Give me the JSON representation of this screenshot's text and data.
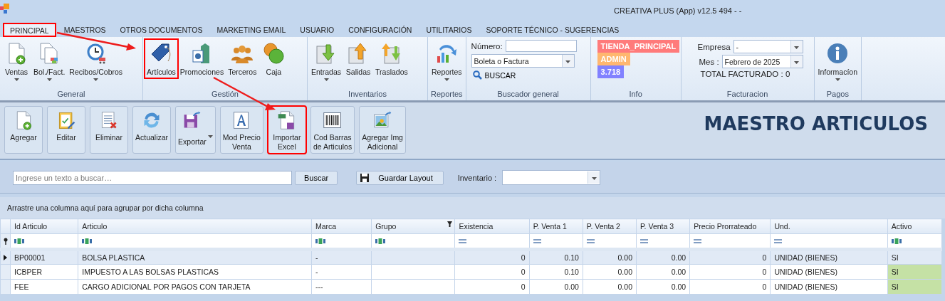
{
  "window": {
    "title": "CREATIVA PLUS (App) v12.5 494 - -"
  },
  "ribbon_tabs": [
    {
      "label": "PRINCIPAL",
      "selected": true,
      "highlighted": true
    },
    {
      "label": "MAESTROS",
      "selected": false,
      "highlighted": false
    },
    {
      "label": "OTROS DOCUMENTOS",
      "selected": false,
      "highlighted": false
    },
    {
      "label": "MARKETING EMAIL",
      "selected": false,
      "highlighted": false
    },
    {
      "label": "USUARIO",
      "selected": false,
      "highlighted": false
    },
    {
      "label": "CONFIGURACIÓN",
      "selected": false,
      "highlighted": false
    },
    {
      "label": "UTILITARIOS",
      "selected": false,
      "highlighted": false
    },
    {
      "label": "SOPORTE TÉCNICO - SUGERENCIAS",
      "selected": false,
      "highlighted": false
    }
  ],
  "ribbon_groups": [
    {
      "kind": "buttons",
      "label": "General",
      "buttons": [
        {
          "label": "Ventas",
          "has_menu": true,
          "highlighted": false
        },
        {
          "label": "Bol./Fact.",
          "has_menu": true,
          "highlighted": false
        },
        {
          "label": "Recibos/Cobros",
          "has_menu": true,
          "highlighted": false
        }
      ]
    },
    {
      "kind": "buttons",
      "label": "Gestión",
      "buttons": [
        {
          "label": "Artículos",
          "has_menu": false,
          "highlighted": true
        },
        {
          "label": "Promociones",
          "has_menu": false,
          "highlighted": false
        },
        {
          "label": "Terceros",
          "has_menu": false,
          "highlighted": false
        },
        {
          "label": "Caja",
          "has_menu": false,
          "highlighted": false
        }
      ]
    },
    {
      "kind": "buttons",
      "label": "Inventarios",
      "buttons": [
        {
          "label": "Entradas",
          "has_menu": true,
          "highlighted": false
        },
        {
          "label": "Salidas",
          "has_menu": false,
          "highlighted": false
        },
        {
          "label": "Traslados",
          "has_menu": false,
          "highlighted": false
        }
      ]
    },
    {
      "kind": "buttons",
      "label": "Reportes",
      "buttons": [
        {
          "label": "Reportes",
          "has_menu": true,
          "highlighted": false
        }
      ]
    },
    {
      "kind": "search",
      "label": "Buscador general",
      "number_label": "Número:",
      "doc_type": "Boleta o Factura",
      "search_link": "BUSCAR"
    },
    {
      "kind": "badges",
      "label": "Info",
      "badges": [
        {
          "text": "TIENDA_PRINCIPAL",
          "color": "#ff7b7b"
        },
        {
          "text": "ADMIN",
          "color": "#ffb76f"
        },
        {
          "text": "3.718",
          "color": "#8181ff"
        }
      ]
    },
    {
      "kind": "billing",
      "label": "Facturacion",
      "company_label": "Empresa",
      "company_value": "-",
      "month_label": "Mes :",
      "month_value": "Febrero de 2025",
      "total": "TOTAL FACTURADO : 0"
    },
    {
      "kind": "buttons",
      "label": "Pagos",
      "buttons": [
        {
          "label": "Informacíon",
          "has_menu": true,
          "highlighted": false
        }
      ]
    }
  ],
  "toolbar": {
    "buttons": [
      {
        "label": "Agregar",
        "has_menu": false,
        "highlighted": false
      },
      {
        "label": "Editar",
        "has_menu": false,
        "highlighted": false
      },
      {
        "label": "Eliminar",
        "has_menu": false,
        "highlighted": false
      },
      {
        "label": "Actualizar",
        "has_menu": false,
        "highlighted": false
      },
      {
        "label": "Exportar",
        "has_menu": true,
        "highlighted": false
      },
      {
        "label": "Mod Precio\nVenta",
        "has_menu": false,
        "highlighted": false
      },
      {
        "label": "Importar\nExcel",
        "has_menu": false,
        "highlighted": true
      },
      {
        "label": "Cod Barras\nde Articulos",
        "has_menu": false,
        "highlighted": false
      },
      {
        "label": "Agregar Img\nAdicional",
        "has_menu": false,
        "highlighted": false
      }
    ],
    "title": "MAESTRO ARTICULOS"
  },
  "search_bar": {
    "placeholder": "Ingrese un texto a buscar…",
    "search_button": "Buscar",
    "save_layout_button": "Guardar Layout",
    "inventory_label": "Inventario :"
  },
  "group_panel_hint": "Arrastre una columna aquí para agrupar por dicha columna",
  "grid": {
    "columns": [
      {
        "label": "Id Articulo",
        "numeric_filter": false,
        "right_aligned": false,
        "filter_icon": false
      },
      {
        "label": "Articulo",
        "numeric_filter": false,
        "right_aligned": false,
        "filter_icon": false
      },
      {
        "label": "Marca",
        "numeric_filter": false,
        "right_aligned": false,
        "filter_icon": false
      },
      {
        "label": "Grupo",
        "numeric_filter": false,
        "filter_icon": true
      },
      {
        "label": "Existencia",
        "numeric_filter": true,
        "right_aligned": true,
        "filter_icon": false
      },
      {
        "label": "P. Venta 1",
        "numeric_filter": true,
        "right_aligned": true,
        "filter_icon": false
      },
      {
        "label": "P. Venta 2",
        "numeric_filter": true,
        "right_aligned": true,
        "filter_icon": false
      },
      {
        "label": "P. Venta 3",
        "numeric_filter": true,
        "right_aligned": true,
        "filter_icon": false
      },
      {
        "label": "Precio Prorrateado",
        "numeric_filter": true,
        "right_aligned": true,
        "filter_icon": false
      },
      {
        "label": "Und.",
        "numeric_filter": true,
        "right_aligned": false,
        "filter_icon": false
      },
      {
        "label": "Activo",
        "numeric_filter": false,
        "right_aligned": false,
        "filter_icon": false
      }
    ],
    "rows": [
      {
        "selected": true,
        "cells": [
          "BP00001",
          "BOLSA PLASTICA",
          "-",
          null,
          "0",
          "0.10",
          "0.00",
          "0.00",
          "0",
          "UNIDAD (BIENES)",
          "SI"
        ]
      },
      {
        "selected": false,
        "cells": [
          "ICBPER",
          "IMPUESTO A LAS BOLSAS PLASTICAS",
          "-",
          null,
          "0",
          "0.10",
          "0.00",
          "0.00",
          "0",
          "UNIDAD (BIENES)",
          "SI"
        ]
      },
      {
        "selected": false,
        "cells": [
          "FEE",
          "CARGO ADICIONAL POR PAGOS CON TARJETA",
          "---",
          null,
          "0",
          "0.00",
          "0.00",
          "0.00",
          "0",
          "UNIDAD (BIENES)",
          "SI"
        ]
      }
    ]
  }
}
